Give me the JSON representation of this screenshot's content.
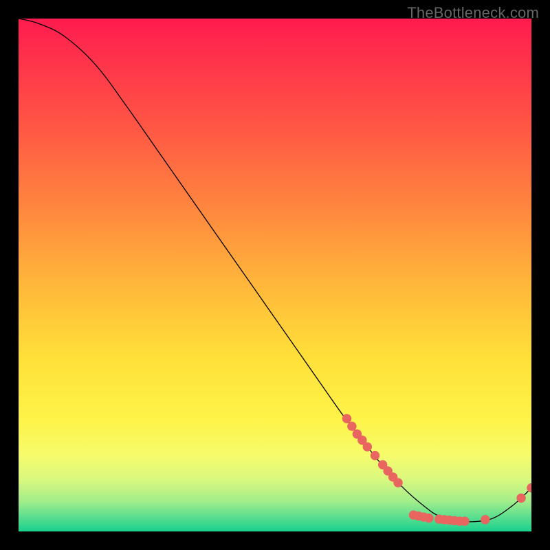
{
  "watermark": "TheBottleneck.com",
  "chart_data": {
    "type": "line",
    "title": "",
    "xlabel": "",
    "ylabel": "",
    "xlim": [
      0,
      100
    ],
    "ylim": [
      0,
      100
    ],
    "grid": false,
    "series": [
      {
        "name": "curve",
        "points": [
          {
            "x": 0,
            "y": 100
          },
          {
            "x": 4,
            "y": 99
          },
          {
            "x": 9,
            "y": 96.5
          },
          {
            "x": 15,
            "y": 91
          },
          {
            "x": 21,
            "y": 83
          },
          {
            "x": 28,
            "y": 73
          },
          {
            "x": 35,
            "y": 63
          },
          {
            "x": 42,
            "y": 53
          },
          {
            "x": 49,
            "y": 43
          },
          {
            "x": 56,
            "y": 33
          },
          {
            "x": 63,
            "y": 23
          },
          {
            "x": 65,
            "y": 20.5
          },
          {
            "x": 70,
            "y": 14
          },
          {
            "x": 75,
            "y": 8.5
          },
          {
            "x": 79,
            "y": 5
          },
          {
            "x": 82,
            "y": 3
          },
          {
            "x": 86,
            "y": 2
          },
          {
            "x": 90,
            "y": 2
          },
          {
            "x": 93,
            "y": 2.8
          },
          {
            "x": 96,
            "y": 4.8
          },
          {
            "x": 98,
            "y": 6.5
          },
          {
            "x": 100,
            "y": 8.5
          }
        ]
      }
    ],
    "markers": [
      {
        "x": 64,
        "y": 22
      },
      {
        "x": 65,
        "y": 20.5
      },
      {
        "x": 66,
        "y": 19
      },
      {
        "x": 67,
        "y": 17.8
      },
      {
        "x": 68,
        "y": 16.5
      },
      {
        "x": 69.5,
        "y": 14.8
      },
      {
        "x": 71,
        "y": 13
      },
      {
        "x": 72,
        "y": 11.8
      },
      {
        "x": 73,
        "y": 10.6
      },
      {
        "x": 74,
        "y": 9.5
      },
      {
        "x": 77,
        "y": 3.2
      },
      {
        "x": 78,
        "y": 3
      },
      {
        "x": 79,
        "y": 2.8
      },
      {
        "x": 80,
        "y": 2.6
      },
      {
        "x": 82,
        "y": 2.4
      },
      {
        "x": 83,
        "y": 2.3
      },
      {
        "x": 84,
        "y": 2.2
      },
      {
        "x": 85,
        "y": 2.1
      },
      {
        "x": 86,
        "y": 2.0
      },
      {
        "x": 87,
        "y": 2.0
      },
      {
        "x": 91,
        "y": 2.3
      },
      {
        "x": 98,
        "y": 6.5
      },
      {
        "x": 100,
        "y": 8.5
      }
    ],
    "marker_color": "#e9655f",
    "line_color": "#000000"
  }
}
